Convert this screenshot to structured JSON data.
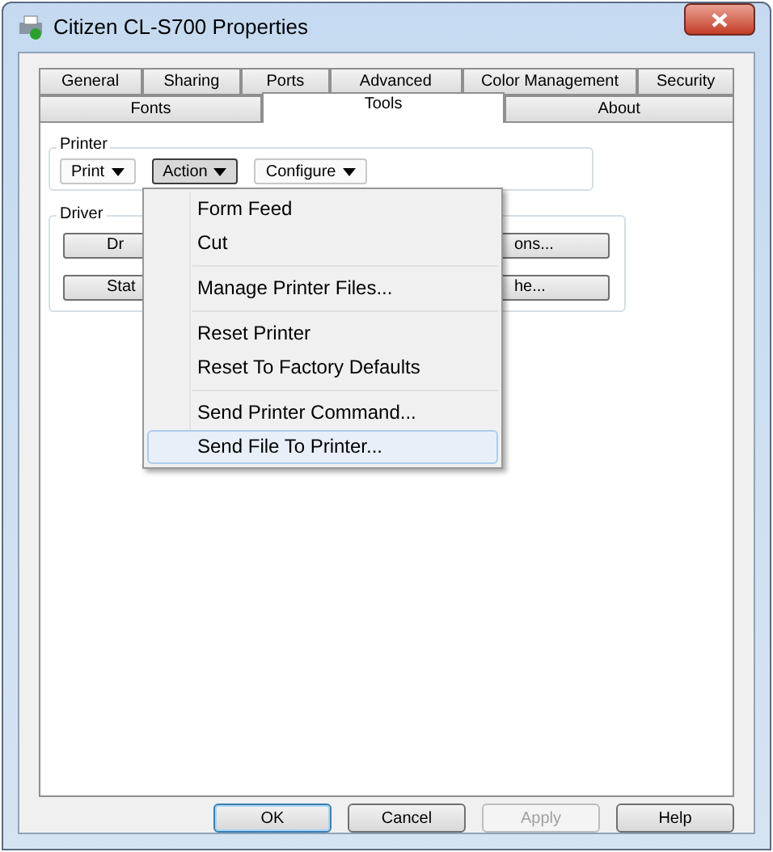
{
  "window": {
    "title": "Citizen CL-S700 Properties"
  },
  "tab_rows": [
    [
      {
        "label": "General",
        "selected": false
      },
      {
        "label": "Sharing",
        "selected": false
      },
      {
        "label": "Ports",
        "selected": false
      },
      {
        "label": "Advanced",
        "selected": false
      },
      {
        "label": "Color Management",
        "selected": false
      },
      {
        "label": "Security",
        "selected": false
      }
    ],
    [
      {
        "label": "Fonts",
        "selected": false
      },
      {
        "label": "Tools",
        "selected": true
      },
      {
        "label": "About",
        "selected": false
      }
    ]
  ],
  "printer_group": {
    "label": "Printer",
    "buttons": [
      {
        "label": "Print",
        "pressed": false
      },
      {
        "label": "Action",
        "pressed": true
      },
      {
        "label": "Configure",
        "pressed": false
      }
    ]
  },
  "driver_group": {
    "label": "Driver",
    "rows": [
      [
        "Dr",
        "ons..."
      ],
      [
        "Stat",
        "he..."
      ]
    ]
  },
  "menu": [
    {
      "kind": "item",
      "label": "Form Feed",
      "selected": false
    },
    {
      "kind": "item",
      "label": "Cut",
      "selected": false
    },
    {
      "kind": "separator"
    },
    {
      "kind": "item",
      "label": "Manage Printer Files...",
      "selected": false
    },
    {
      "kind": "separator"
    },
    {
      "kind": "item",
      "label": "Reset Printer",
      "selected": false
    },
    {
      "kind": "item",
      "label": "Reset To Factory Defaults",
      "selected": false
    },
    {
      "kind": "separator"
    },
    {
      "kind": "item",
      "label": "Send Printer Command...",
      "selected": false
    },
    {
      "kind": "item",
      "label": "Send File To Printer...",
      "selected": true
    }
  ],
  "footer_buttons": [
    {
      "label": "OK",
      "default": true,
      "disabled": false
    },
    {
      "label": "Cancel",
      "default": false,
      "disabled": false
    },
    {
      "label": "Apply",
      "default": false,
      "disabled": true
    },
    {
      "label": "Help",
      "default": false,
      "disabled": false
    }
  ]
}
